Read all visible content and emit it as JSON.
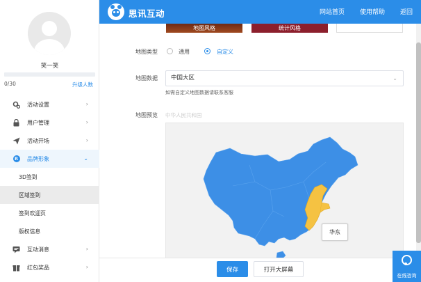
{
  "header": {
    "brand": "思讯互动",
    "nav": [
      "网站首页",
      "使用帮助",
      "返回"
    ]
  },
  "sidebar": {
    "username": "笑一笑",
    "quota": "0/30",
    "upgrade": "升级人数",
    "menu": [
      {
        "label": "活动设置",
        "icon": "gear-icon"
      },
      {
        "label": "用户管理",
        "icon": "lock-icon"
      },
      {
        "label": "活动开场",
        "icon": "send-icon"
      },
      {
        "label": "品牌形象",
        "icon": "r-badge-icon"
      }
    ],
    "sub_items": [
      "3D签到",
      "区域签到",
      "签到欢迎页",
      "版权信息"
    ],
    "menu_bottom": [
      {
        "label": "互动消息",
        "icon": "message-icon"
      },
      {
        "label": "红包奖品",
        "icon": "gift-icon"
      }
    ]
  },
  "main": {
    "style_thumbs": [
      "地图风格",
      "统计风格"
    ],
    "map_type": {
      "label": "地图类型",
      "options": [
        "通用",
        "自定义"
      ],
      "selected": "自定义"
    },
    "map_data": {
      "label": "地图数据",
      "value": "中国大区",
      "hint": "如需自定义地图数据请联系客服"
    },
    "preview": {
      "label": "地图预览",
      "title": "中华人民共和国",
      "tooltip": "华东"
    }
  },
  "footer": {
    "save": "保存",
    "fullscreen": "打开大屏幕"
  },
  "consult": {
    "label": "在线咨询"
  },
  "colors": {
    "primary": "#2b8de8",
    "map_base": "#3d8fe6",
    "map_highlight": "#f5c242"
  }
}
